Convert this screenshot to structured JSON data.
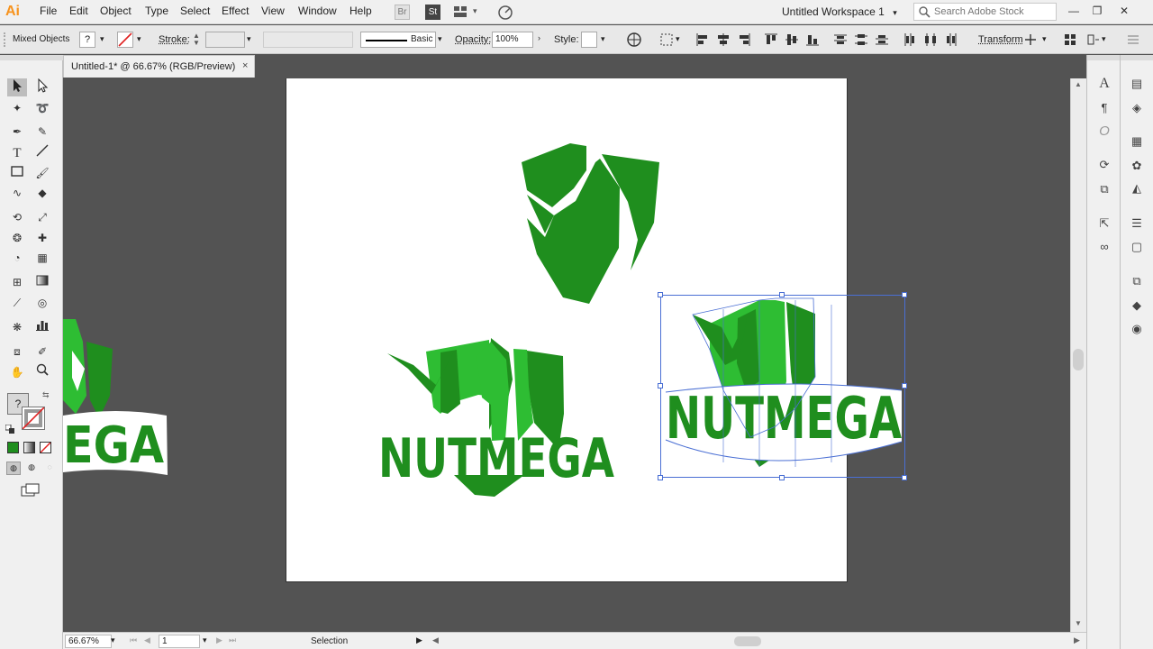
{
  "app": {
    "logo": "Ai"
  },
  "menu": [
    "File",
    "Edit",
    "Object",
    "Type",
    "Select",
    "Effect",
    "View",
    "Window",
    "Help"
  ],
  "menubar_icons": {
    "bridge": "Br",
    "stock": "St"
  },
  "workspace": "Untitled Workspace 1",
  "search": {
    "placeholder": "Search Adobe Stock"
  },
  "control": {
    "selection_type": "Mixed Objects",
    "fill_value": "?",
    "stroke_label": "Stroke:",
    "brush_label": "Basic",
    "opacity_label": "Opacity:",
    "opacity_value": "100%",
    "style_label": "Style:",
    "transform_label": "Transform"
  },
  "document": {
    "tab_title": "Untitled-1* @ 66.67% (RGB/Preview)",
    "close": "×"
  },
  "colors": {
    "logo_dark": "#1f8e1e",
    "logo_light": "#2ebd33",
    "selection": "#4a6fd4",
    "artboard": "#ffffff",
    "pasteboard": "#535353"
  },
  "artwork": {
    "text_middle": "NUTMEGA",
    "text_right": "NUTMEGA",
    "text_left": "EGA"
  },
  "status": {
    "zoom": "66.67%",
    "artboard_number": "1",
    "tool": "Selection"
  }
}
